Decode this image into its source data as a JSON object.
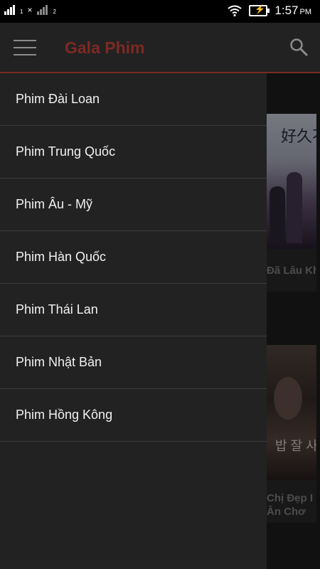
{
  "status_bar": {
    "sim1_label": "1",
    "sim2_label": "2",
    "sim2_prefix": "×",
    "time": "1:57",
    "ampm": "PM",
    "icons": [
      "signal-icon",
      "signal-2-icon",
      "wifi-icon",
      "battery-charging-icon"
    ]
  },
  "app_bar": {
    "title": "Gala Phim",
    "title_color": "#7d2a23",
    "menu_icon": "hamburger-icon",
    "search_icon": "search-icon"
  },
  "drawer": {
    "items": [
      {
        "label": "Phim Đài Loan"
      },
      {
        "label": "Phim Trung Quốc"
      },
      {
        "label": "Phim Âu - Mỹ"
      },
      {
        "label": "Phim Hàn Quốc"
      },
      {
        "label": "Phim Thái Lan"
      },
      {
        "label": "Phim Nhật Bản"
      },
      {
        "label": "Phim Hồng Kông"
      }
    ]
  },
  "background_cards": [
    {
      "title": "Đã Lâu Kho",
      "poster_text": "好久不"
    },
    {
      "title_line1": "Chị Đẹp I",
      "title_line2": "Ăn Chơ",
      "poster_text": "밥 잘 사"
    }
  ],
  "colors": {
    "accent": "#7d2a23",
    "drawer_bg": "#222222",
    "divider": "#3d3d3d"
  }
}
